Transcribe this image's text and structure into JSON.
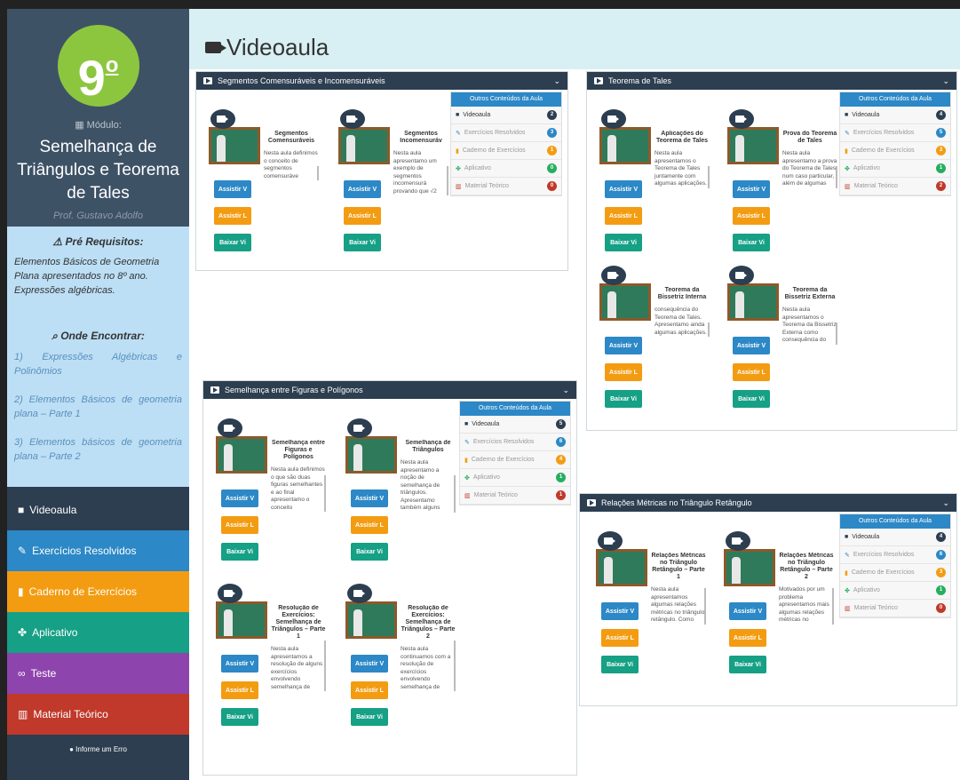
{
  "sidebar": {
    "logo": "9",
    "logo_sup": "o",
    "module_label": "Módulo:",
    "module_title": "Semelhança de Triângulos e Teorema de Tales",
    "professor": "Prof. Gustavo Adolfo",
    "prereq_title": "Pré Requisitos:",
    "prereq_text": "Elementos Básicos de Geometria Plana apresentados no 8º ano. Expressões algébricas.",
    "where_title": "Onde Encontrar:",
    "where_items": [
      "1) Expressões Algébricas e Polinômios",
      "2) Elementos Básicos de geometria plana – Parte 1",
      "3) Elementos básicos de geometria plana – Parte 2"
    ],
    "nav": [
      {
        "label": "Videoaula",
        "color": "#2c3e50"
      },
      {
        "label": "Exercícios Resolvidos",
        "color": "#2c88c6"
      },
      {
        "label": "Caderno de Exercícios",
        "color": "#f39c12"
      },
      {
        "label": "Aplicativo",
        "color": "#16a085"
      },
      {
        "label": "Teste",
        "color": "#8e44ad"
      },
      {
        "label": "Material Teórico",
        "color": "#c0392b"
      }
    ],
    "report": "Informe um Erro"
  },
  "main": {
    "title": "Videoaula"
  },
  "other_contents": {
    "header": "Outros Conteúdos da Aula",
    "items": [
      {
        "label": "Videoaula",
        "badge_color": "#2c3e50"
      },
      {
        "label": "Exercícios Resolvidos",
        "badge_color": "#2c88c6"
      },
      {
        "label": "Caderno de Exercícios",
        "badge_color": "#f39c12"
      },
      {
        "label": "Aplicativo",
        "badge_color": "#27ae60"
      },
      {
        "label": "Material Teórico",
        "badge_color": "#c0392b"
      }
    ]
  },
  "buttons": {
    "watch": "Assistir V",
    "watch_libras": "Assistir L",
    "download": "Baixar Vi"
  },
  "panels": [
    {
      "title": "Segmentos Comensuráveis e Incomensuráveis",
      "badges": [
        "2",
        "3",
        "1",
        "0",
        "0"
      ],
      "cards": [
        {
          "title": "Segmentos Comensuráveis",
          "text": "Nesta aula definimos o conceito de segmentos comensuráve"
        },
        {
          "title": "Segmentos Incomensuráv",
          "text": "Nesta aula apresentamo um exemplo de segmentos incomensurá provando que √2"
        }
      ]
    },
    {
      "title": "Teorema de Tales",
      "badges": [
        "4",
        "5",
        "3",
        "1",
        "2"
      ],
      "cards": [
        {
          "title": "Aplicações do Teorema de Tales",
          "text": "Nesta aula apresentamos o Teorema de Tales juntamente com algumas aplicações."
        },
        {
          "title": "Prova do Teorema de Tales",
          "text": "Nesta aula apresentamo a prova do Teorema de Tales, num caso particular, além de algumas"
        },
        {
          "title": "Teorema da Bissetriz Interna",
          "text": "consequência do Teorema de Tales. Apresentamo ainda algumas aplicações."
        },
        {
          "title": "Teorema da Bissetriz Externa",
          "text": "Nesta aula apresentamos o Teorema da Bissetriz Externa como consequência do"
        }
      ]
    },
    {
      "title": "Semelhança entre Figuras e Polígonos",
      "badges": [
        "5",
        "6",
        "4",
        "1",
        "1"
      ],
      "cards": [
        {
          "title": "Semelhança entre Figuras e Polígonos",
          "text": "Nesta aula definimos o que são duas figuras semelhantes e ao final apresentamo o conceito"
        },
        {
          "title": "Semelhança de Triângulos",
          "text": "Nesta aula apresentamo a noção de semelhança de triângulos. Apresentamo também alguns"
        },
        {
          "title": "Resolução de Exercícios: Semelhança de Triângulos – Parte 1",
          "text": "Nesta aula apresentamos a resolução de alguns exercícios envolvendo semelhança de"
        },
        {
          "title": "Resolução de Exercícios: Semelhança de Triângulos – Parte 2",
          "text": "Nesta aula continuamos com a resolução de exercícios envolvendo semelhança de"
        }
      ]
    },
    {
      "title": "Relações Métricas no Triângulo Retângulo",
      "badges": [
        "4",
        "6",
        "3",
        "1",
        "0"
      ],
      "cards": [
        {
          "title": "Relações Métricas no Triângulo Retângulo – Parte 1",
          "text": "Nesta aula apresentamos algumas relações métricas no triângulo retângulo. Como"
        },
        {
          "title": "Relações Métricas no Triângulo Retângulo – Parte 2",
          "text": "Motivados por um problema apresentamos mais algumas relações métricas no"
        }
      ]
    }
  ]
}
